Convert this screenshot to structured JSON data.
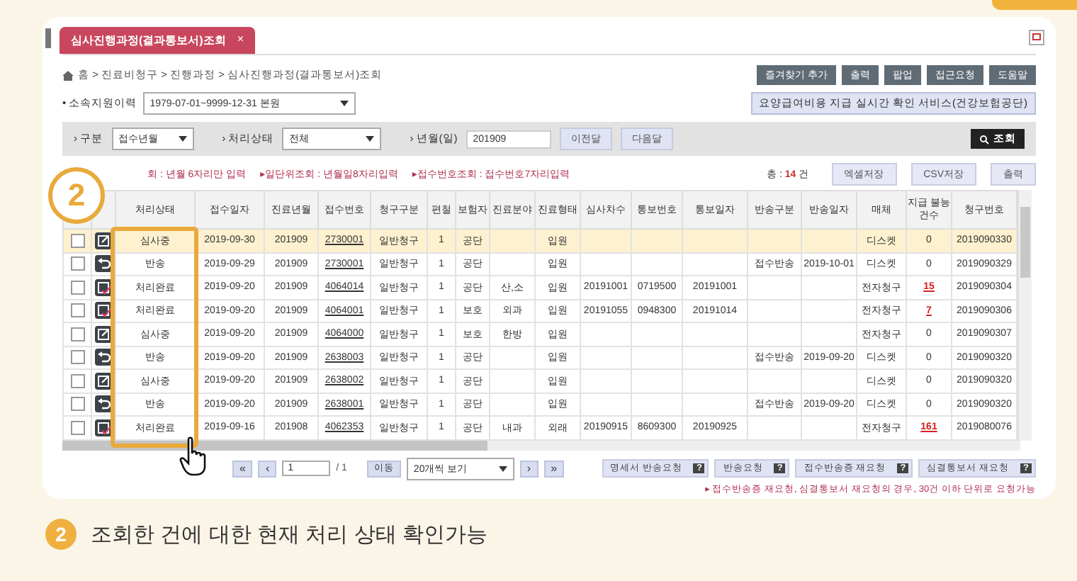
{
  "tab": {
    "title": "심사진행과정(결과통보서)조회",
    "close": "×"
  },
  "breadcrumb": "홈 > 진료비청구 > 진행과정 > 심사진행과정(결과통보서)조회",
  "header_buttons": [
    "즐겨찾기 추가",
    "출력",
    "팝업",
    "접근요청",
    "도움말"
  ],
  "affiliation": {
    "label": "• 소속지원이력",
    "value": "1979-07-01~9999-12-31 본원"
  },
  "service_button": "요양급여비용 지급 실시간 확인 서비스(건강보험공단)",
  "filters": {
    "type_label": "› 구분",
    "type_value": "접수년월",
    "status_label": "› 처리상태",
    "status_value": "전체",
    "period_label": "› 년월(일)",
    "period_value": "201909",
    "prev": "이전달",
    "next": "다음달",
    "search": "조회"
  },
  "notices": [
    "회 : 년월 6자리만 입력",
    "▸일단위조회 : 년월일8자리입력",
    "▸접수번호조회 : 접수번호7자리입력"
  ],
  "total": {
    "prefix": "총 :",
    "count": "14",
    "suffix": "건"
  },
  "export_buttons": [
    "엑셀저장",
    "CSV저장",
    "출력"
  ],
  "table": {
    "columns": [
      {
        "label": "처리상태",
        "kind": "text"
      },
      {
        "label": "접수일자",
        "kind": "text"
      },
      {
        "label": "진료년월",
        "kind": "text"
      },
      {
        "label": "접수번호",
        "kind": "link"
      },
      {
        "label": "청구구분",
        "kind": "text"
      },
      {
        "label": "편철",
        "kind": "text"
      },
      {
        "label": "보험자",
        "kind": "text"
      },
      {
        "label": "진료분야",
        "kind": "text"
      },
      {
        "label": "진료형태",
        "kind": "text"
      },
      {
        "label": "심사차수",
        "kind": "text"
      },
      {
        "label": "통보번호",
        "kind": "text"
      },
      {
        "label": "통보일자",
        "kind": "text"
      },
      {
        "label": "반송구분",
        "kind": "text"
      },
      {
        "label": "반송일자",
        "kind": "text"
      },
      {
        "label": "매체",
        "kind": "text"
      },
      {
        "label": "지급 불능건수",
        "kind": "count"
      },
      {
        "label": "청구번호",
        "kind": "text"
      }
    ],
    "rows": [
      {
        "kind": "edit",
        "selected": true,
        "flagged": false,
        "cells": [
          "심사중",
          "2019-09-30",
          "201909",
          "2730001",
          "일반청구",
          "1",
          "공단",
          "",
          "입원",
          "",
          "",
          "",
          "",
          "",
          "디스켓",
          "0",
          "2019090330"
        ]
      },
      {
        "kind": "return",
        "selected": false,
        "flagged": false,
        "cells": [
          "반송",
          "2019-09-29",
          "201909",
          "2730001",
          "일반청구",
          "1",
          "공단",
          "",
          "입원",
          "",
          "",
          "",
          "접수반송",
          "2019-10-01",
          "디스켓",
          "0",
          "2019090329"
        ]
      },
      {
        "kind": "done",
        "selected": false,
        "flagged": true,
        "cells": [
          "처리완료",
          "2019-09-20",
          "201909",
          "4064014",
          "일반청구",
          "1",
          "공단",
          "산,소",
          "입원",
          "20191001",
          "0719500",
          "20191001",
          "",
          "",
          "전자청구",
          "15",
          "2019090304"
        ]
      },
      {
        "kind": "done",
        "selected": false,
        "flagged": true,
        "cells": [
          "처리완료",
          "2019-09-20",
          "201909",
          "4064001",
          "일반청구",
          "1",
          "보호",
          "외과",
          "입원",
          "20191055",
          "0948300",
          "20191014",
          "",
          "",
          "전자청구",
          "7",
          "2019090306"
        ]
      },
      {
        "kind": "edit",
        "selected": false,
        "flagged": false,
        "cells": [
          "심사중",
          "2019-09-20",
          "201909",
          "4064000",
          "일반청구",
          "1",
          "보호",
          "한방",
          "입원",
          "",
          "",
          "",
          "",
          "",
          "전자청구",
          "0",
          "2019090307"
        ]
      },
      {
        "kind": "return",
        "selected": false,
        "flagged": false,
        "cells": [
          "반송",
          "2019-09-20",
          "201909",
          "2638003",
          "일반청구",
          "1",
          "공단",
          "",
          "입원",
          "",
          "",
          "",
          "접수반송",
          "2019-09-20",
          "디스켓",
          "0",
          "2019090320"
        ]
      },
      {
        "kind": "edit",
        "selected": false,
        "flagged": false,
        "cells": [
          "심사중",
          "2019-09-20",
          "201909",
          "2638002",
          "일반청구",
          "1",
          "공단",
          "",
          "입원",
          "",
          "",
          "",
          "",
          "",
          "디스켓",
          "0",
          "2019090320"
        ]
      },
      {
        "kind": "return",
        "selected": false,
        "flagged": false,
        "cells": [
          "반송",
          "2019-09-20",
          "201909",
          "2638001",
          "일반청구",
          "1",
          "공단",
          "",
          "입원",
          "",
          "",
          "",
          "접수반송",
          "2019-09-20",
          "디스켓",
          "0",
          "2019090320"
        ]
      },
      {
        "kind": "done",
        "selected": false,
        "flagged": true,
        "cells": [
          "처리완료",
          "2019-09-16",
          "201908",
          "4062353",
          "일반청구",
          "1",
          "공단",
          "내과",
          "외래",
          "20190915",
          "8609300",
          "20190925",
          "",
          "",
          "전자청구",
          "161",
          "2019080076"
        ]
      }
    ]
  },
  "pagination": {
    "first": "«",
    "prev": "‹",
    "page": "1",
    "total": "/ 1",
    "go": "이동",
    "page_size": "20개씩 보기",
    "next": "›",
    "last": "»"
  },
  "action_buttons": [
    {
      "label": "명세서 반송요청",
      "help": "?"
    },
    {
      "label": "반송요청",
      "help": "?"
    },
    {
      "label": "접수반송증 재요청",
      "help": "?"
    },
    {
      "label": "심결통보서 재요청",
      "help": "?"
    }
  ],
  "note": "▸ 접수반송증 재요청, 심결통보서 재요청의 경우, 30건 이하 단위로 요청가능",
  "badge": "2",
  "callout": {
    "number": "2",
    "text": "조회한 건에 대한 현재 처리 상태 확인가능"
  }
}
